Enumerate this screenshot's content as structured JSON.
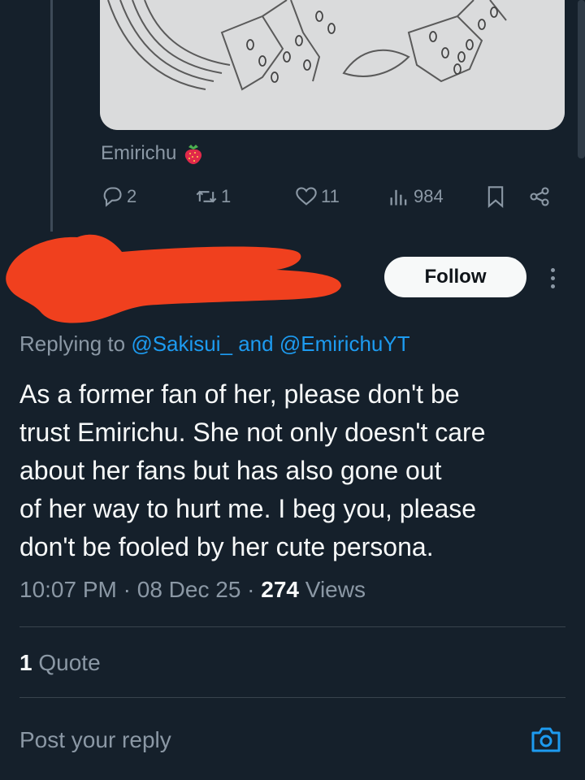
{
  "quoted_post": {
    "author_name": "Emirichu",
    "author_emoji": "strawberry-icon",
    "stats": {
      "replies": "2",
      "reposts": "1",
      "likes": "11",
      "views": "984"
    }
  },
  "reply_post": {
    "follow_label": "Follow",
    "replying_prefix": "Replying to",
    "replying_to_1": "@Sakisui_",
    "replying_joiner": "and",
    "replying_to_2": "@EmirichuYT",
    "text_lines": [
      "As a former fan of her, please don't be",
      "trust Emirichu. She not only doesn't care",
      "about her fans but has also gone out",
      "of her way to hurt me. I beg you, please",
      "don't be fooled by her cute persona."
    ],
    "time": "10:07 PM",
    "date": "08 Dec 25",
    "views_count": "274",
    "views_label": "Views",
    "quote_count": "1",
    "quote_label": "Quote"
  },
  "composer": {
    "placeholder": "Post your reply"
  },
  "colors": {
    "background": "#15202b",
    "accent": "#1d9bf0",
    "secondary_text": "#8b98a5",
    "redaction": "#f0401e"
  }
}
